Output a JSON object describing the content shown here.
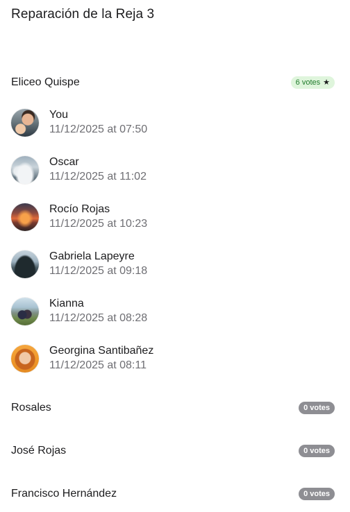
{
  "title": "Reparación de la Reja 3",
  "options": [
    {
      "name": "Eliceo Quispe",
      "votes_label": "6 votes",
      "winner": true,
      "voters": [
        {
          "name": "You",
          "time": "11/12/2025 at 07:50"
        },
        {
          "name": "Oscar",
          "time": "11/12/2025 at 11:02"
        },
        {
          "name": "Rocío Rojas",
          "time": "11/12/2025 at 10:23"
        },
        {
          "name": "Gabriela Lapeyre",
          "time": "11/12/2025 at 09:18"
        },
        {
          "name": "Kianna",
          "time": "11/12/2025 at 08:28"
        },
        {
          "name": "Georgina Santibañez",
          "time": "11/12/2025 at 08:11"
        }
      ]
    },
    {
      "name": "Rosales",
      "votes_label": "0 votes",
      "winner": false
    },
    {
      "name": "José Rojas",
      "votes_label": "0 votes",
      "winner": false
    },
    {
      "name": "Francisco Hernández",
      "votes_label": "0 votes",
      "winner": false
    }
  ],
  "icons": {
    "winner_badge": "star-icon"
  },
  "colors": {
    "winner_badge_bg": "#dff5dc",
    "winner_badge_text": "#1e7a2a",
    "zero_badge_bg": "#8e8e93",
    "secondary_text": "#6e6e73"
  }
}
